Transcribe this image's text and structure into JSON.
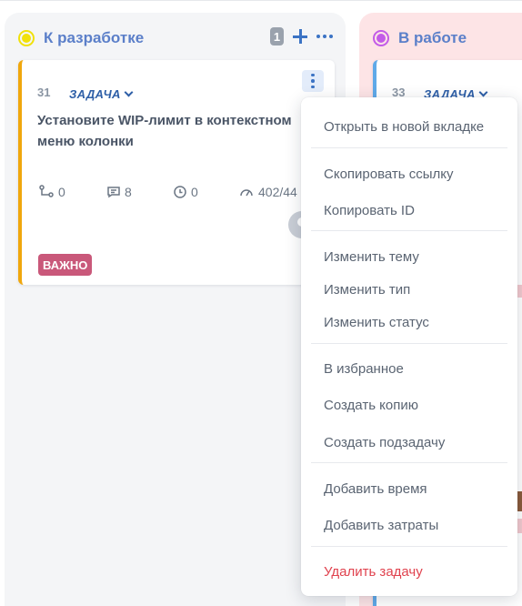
{
  "columns": [
    {
      "title": "К разработке",
      "status_color": "#f1e10a",
      "count": "1",
      "card": {
        "id": "31",
        "type": "ЗАДАЧА",
        "title": "Установите WIP-лимит в контекстном меню колонки",
        "stats": {
          "subtasks": "0",
          "comments": "8",
          "time": "0",
          "estimate": "402/44"
        },
        "tag": "ВАЖНО",
        "border_color": "#f0a70c"
      }
    },
    {
      "title": "В работе",
      "status_color": "#c35be8",
      "card": {
        "id": "33",
        "type": "ЗАДАЧА",
        "border_color": "#5fa9e8"
      }
    }
  ],
  "context_menu": {
    "groups": [
      [
        "Открыть в новой вкладке"
      ],
      [
        "Скопировать ссылку",
        "Копировать ID"
      ],
      [
        "Изменить тему",
        "Изменить тип",
        "Изменить статус"
      ],
      [
        "В избранное",
        "Создать копию",
        "Создать подзадачу"
      ],
      [
        "Добавить время",
        "Добавить затраты"
      ],
      [
        "Удалить задачу"
      ]
    ],
    "danger_color": "#e0424e"
  },
  "icons": {
    "subtasks": "subtasks-icon",
    "comments": "comment-icon",
    "time": "clock-icon",
    "estimate": "gauge-icon"
  }
}
